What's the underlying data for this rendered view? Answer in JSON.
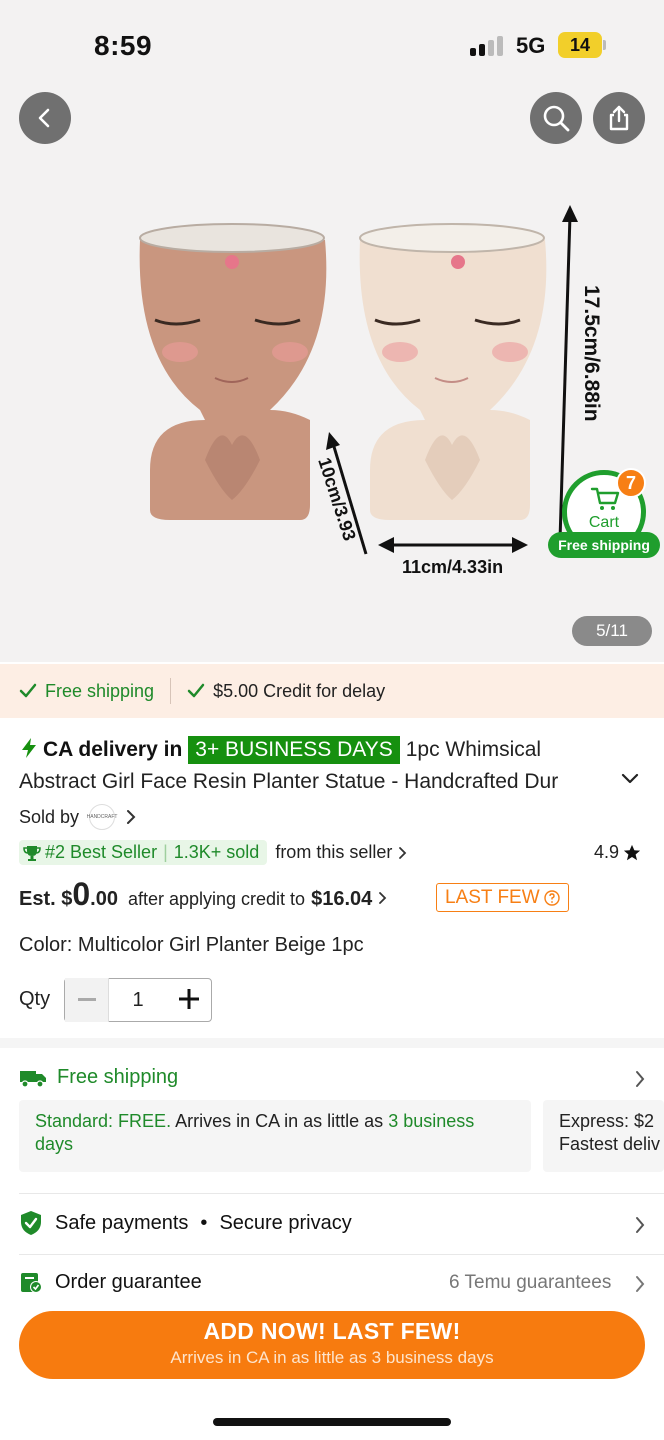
{
  "status_bar": {
    "time": "8:59",
    "network": "5G",
    "battery": "14"
  },
  "gallery": {
    "counter": "5/11",
    "dimension_labels": {
      "height": "17.5cm/6.88in",
      "depth": "10cm/3.93",
      "width": "11cm/4.33in"
    }
  },
  "cart": {
    "label": "Cart",
    "count": "7",
    "shipping": "Free shipping"
  },
  "shipping_strip": {
    "free_shipping": "Free shipping",
    "credit": "$5.00 Credit for delay"
  },
  "product": {
    "delivery_prefix": "CA delivery in",
    "delivery_badge": "3+ BUSINESS DAYS",
    "title": "1pc Whimsical Abstract Girl Face Resin Planter Statue - Handcrafted Dur",
    "sold_by": "Sold by",
    "seller_logo_text": "HANDCRAFT",
    "best_seller": "#2 Best Seller",
    "sold_count": "1.3K+ sold",
    "from_seller": "from this seller",
    "rating": "4.9",
    "est_label": "Est. $",
    "price_whole": "0",
    "price_cents": ".00",
    "after_credit": "after applying credit to",
    "credit_amount": "$16.04",
    "last_few": "LAST FEW",
    "color": "Color: Multicolor Girl Planter Beige 1pc",
    "qty_label": "Qty",
    "qty_value": "1"
  },
  "shipping": {
    "title": "Free shipping",
    "standard_label": "Standard: FREE.",
    "standard_text": "Arrives in CA in as little as",
    "standard_days": "3 business days",
    "express_line1": "Express: $2",
    "express_line2": "Fastest deliv"
  },
  "rows": {
    "safe_payments": "Safe payments",
    "secure_privacy": "Secure privacy",
    "order_guarantee": "Order guarantee",
    "guarantees": "6 Temu guarantees"
  },
  "cta": {
    "title": "ADD NOW! LAST FEW!",
    "subtitle": "Arrives in CA in as little as 3 business days"
  },
  "colors": {
    "green": "#1f8a2a",
    "orange": "#f77b0f",
    "badge_green": "#16900f"
  }
}
